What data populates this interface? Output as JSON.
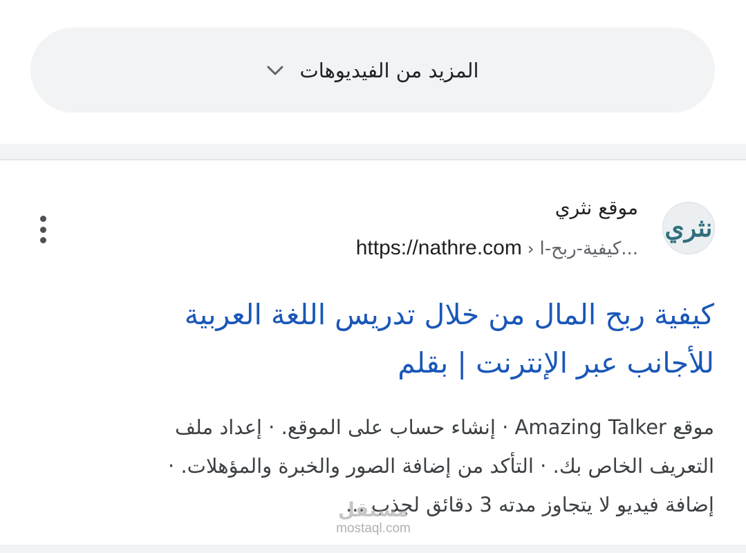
{
  "more_videos": {
    "label": "المزيد من الفيديوهات",
    "icon": "chevron-down-icon"
  },
  "result": {
    "site": {
      "logo_text": "نثري",
      "name": "موقع نثري",
      "url_domain": "https://nathre.com",
      "url_separator": "›",
      "url_path": "كيفية-ربح-ا..."
    },
    "menu_icon": "more-vert-icon",
    "title_lines": [
      "كيفية ربح المال من خلال تدريس اللغة العربية",
      "للأجانب عبر الإنترنت | بقلم"
    ],
    "snippet_lines": [
      "موقع Amazing Talker · إنشاء حساب على الموقع. · إعداد ملف",
      "التعريف الخاص بك. · التأكد من إضافة الصور والخبرة والمؤهلات. ·",
      "إضافة فيديو لا يتجاوز مدته 3 دقائق لجذب ..."
    ]
  },
  "watermark": {
    "logo_text": "مستقل",
    "domain": "mostaql.com"
  },
  "colors": {
    "link": "#1a57b8",
    "pill_bg": "#f1f3f4",
    "text": "#202124",
    "snippet": "#3c4043"
  }
}
